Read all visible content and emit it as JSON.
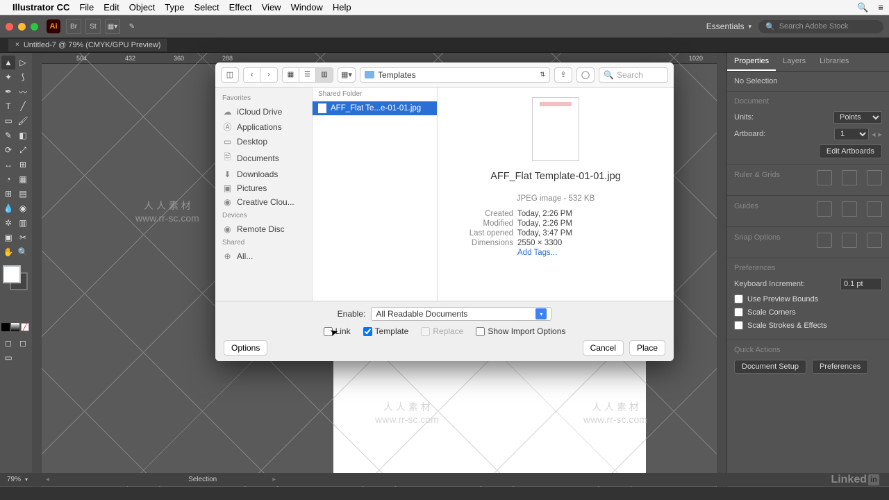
{
  "menubar": {
    "appname": "Illustrator CC",
    "items": [
      "File",
      "Edit",
      "Object",
      "Type",
      "Select",
      "Effect",
      "View",
      "Window",
      "Help"
    ]
  },
  "appbar": {
    "br": "Br",
    "st": "St",
    "workspace": "Essentials",
    "stock_placeholder": "Search Adobe Stock"
  },
  "doctab": {
    "title": "Untitled-7 @ 79% (CMYK/GPU Preview)"
  },
  "ruler": {
    "m504": "504",
    "m432": "432",
    "m360": "360",
    "m288": "288",
    "p1020": "1020"
  },
  "watermark": {
    "cn": "人 人 素 材",
    "url": "www.rr-sc.com"
  },
  "panels": {
    "tabs": {
      "properties": "Properties",
      "layers": "Layers",
      "libraries": "Libraries"
    },
    "nosel": "No Selection",
    "document": "Document",
    "units_lbl": "Units:",
    "units_val": "Points",
    "artboard_lbl": "Artboard:",
    "artboard_val": "1",
    "edit_artboards": "Edit Artboards",
    "ruler_grids": "Ruler & Grids",
    "guides": "Guides",
    "snap": "Snap Options",
    "prefs": "Preferences",
    "kbd_lbl": "Keyboard Increment:",
    "kbd_val": "0.1 pt",
    "cb1": "Use Preview Bounds",
    "cb2": "Scale Corners",
    "cb3": "Scale Strokes & Effects",
    "qa": "Quick Actions",
    "doc_setup": "Document Setup",
    "prefs_btn": "Preferences"
  },
  "status": {
    "zoom": "79%",
    "tool": "Selection"
  },
  "finder": {
    "path": "Templates",
    "search_placeholder": "Search",
    "side": {
      "favorites": "Favorites",
      "items": [
        "iCloud Drive",
        "Applications",
        "Desktop",
        "Documents",
        "Downloads",
        "Pictures",
        "Creative Clou..."
      ],
      "devices": "Devices",
      "remote": "Remote Disc",
      "shared": "Shared",
      "all": "All..."
    },
    "col_header": "Shared Folder",
    "file_short": "AFF_Flat Te...e-01-01.jpg",
    "preview": {
      "name": "AFF_Flat Template-01-01.jpg",
      "kind": "JPEG image - 532 KB",
      "created_lbl": "Created",
      "created": "Today, 2:26 PM",
      "modified_lbl": "Modified",
      "modified": "Today, 2:26 PM",
      "opened_lbl": "Last opened",
      "opened": "Today, 3:47 PM",
      "dim_lbl": "Dimensions",
      "dim": "2550 × 3300",
      "tags": "Add Tags..."
    },
    "enable_lbl": "Enable:",
    "enable_val": "All Readable Documents",
    "cb_link": "Link",
    "cb_template": "Template",
    "cb_replace": "Replace",
    "cb_show": "Show Import Options",
    "options": "Options",
    "cancel": "Cancel",
    "place": "Place"
  }
}
